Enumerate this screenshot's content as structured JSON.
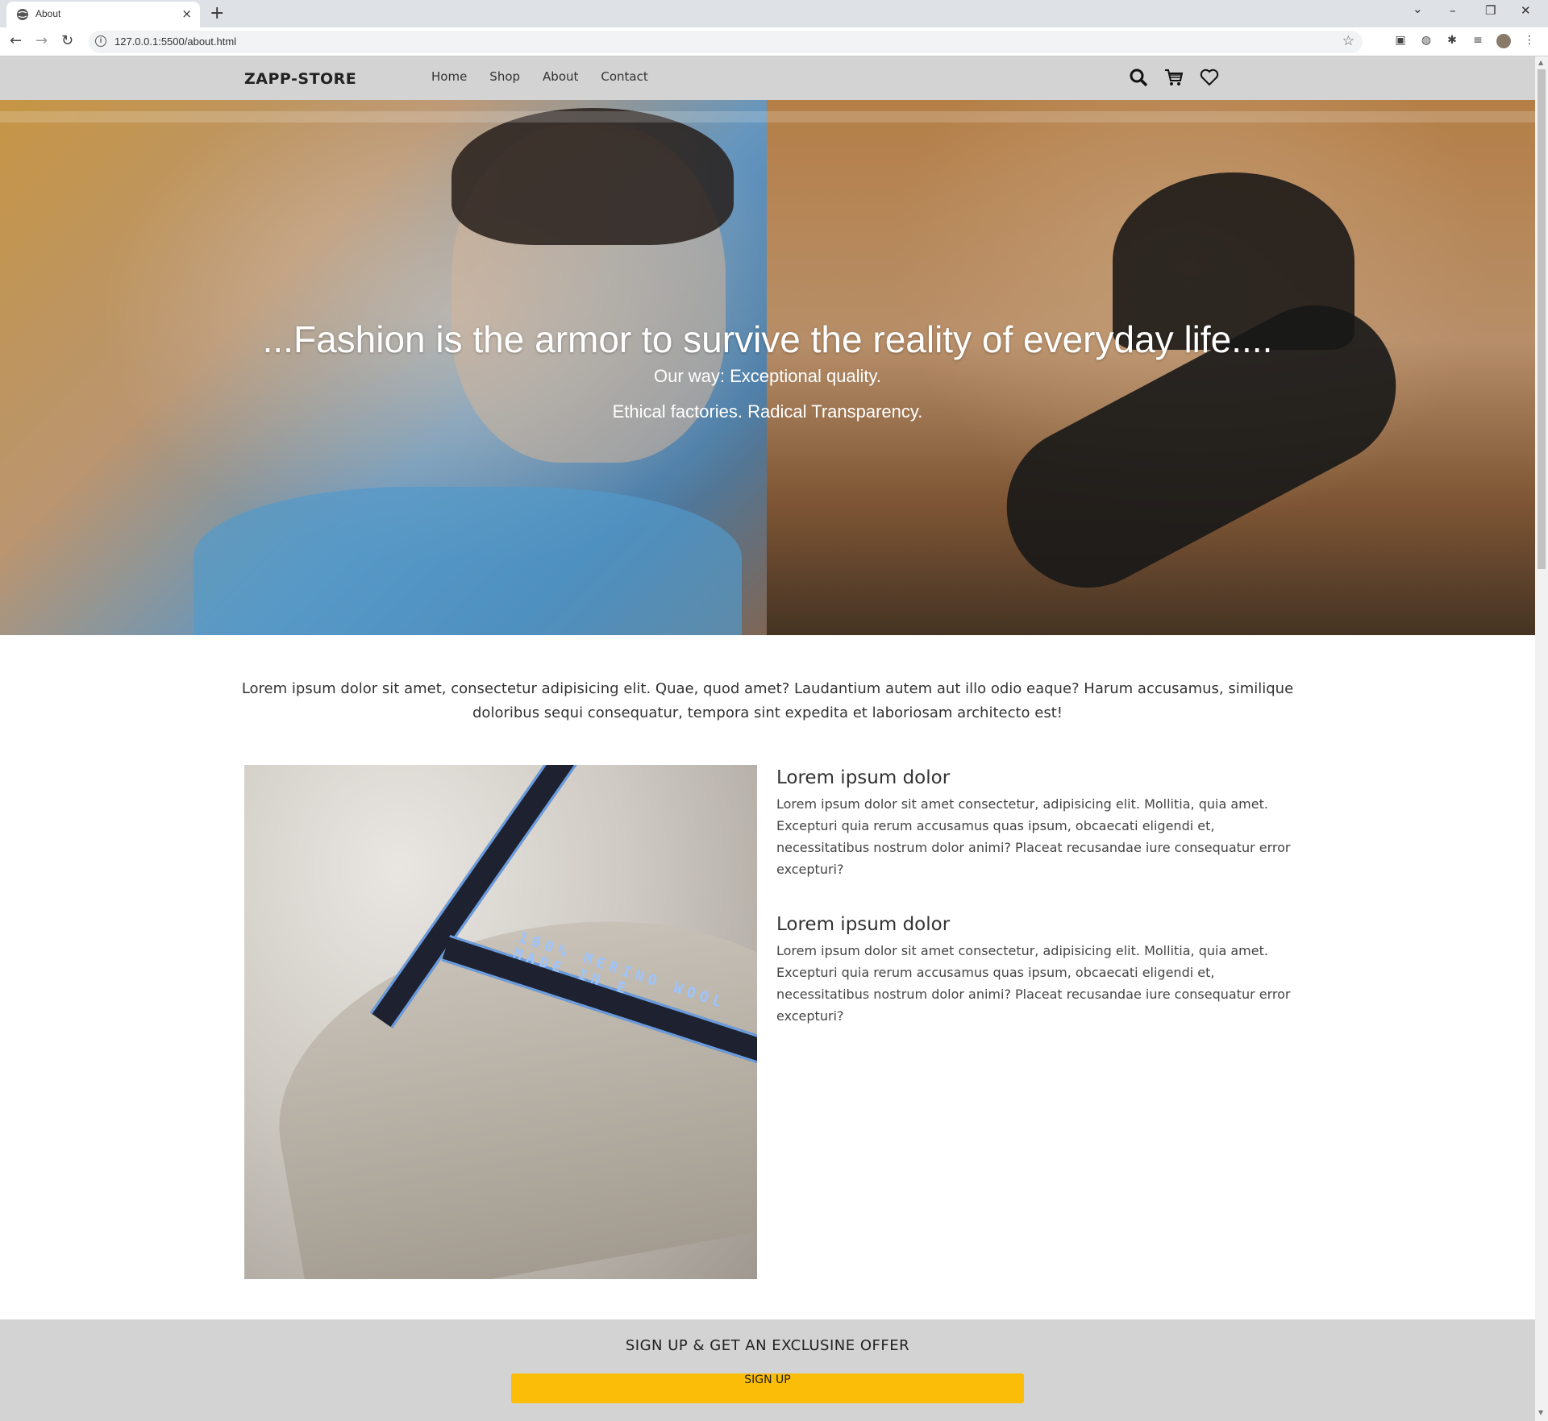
{
  "browser": {
    "tab_title": "About",
    "tab_close": "×",
    "new_tab": "+",
    "url": "127.0.0.1:5500/about.html",
    "window_controls": [
      "–",
      "❐",
      "✕"
    ]
  },
  "nav": {
    "brand": "ZAPP-STORE",
    "links": [
      "Home",
      "Shop",
      "About",
      "Contact"
    ],
    "icons": [
      "search-icon",
      "cart-icon",
      "heart-icon"
    ]
  },
  "hero": {
    "quote": "...Fashion is the armor to survive the reality of everyday life....",
    "line1": "Our way: Exceptional quality.",
    "line2": "Ethical factories. Radical Transparency."
  },
  "intro": "Lorem ipsum dolor sit amet, consectetur adipisicing elit. Quae, quod amet? Laudantium autem aut illo odio eaque? Harum accusamus, similique doloribus sequi consequatur, tempora sint expedita et laboriosam architecto est!",
  "image_text": "100% MERINO WOOL MADE IN E",
  "blocks": [
    {
      "title": "Lorem ipsum dolor",
      "text": "Lorem ipsum dolor sit amet consectetur, adipisicing elit. Mollitia, quia amet. Excepturi quia rerum accusamus quas ipsum, obcaecati eligendi et, necessitatibus nostrum dolor animi? Placeat recusandae iure consequatur error excepturi?"
    },
    {
      "title": "Lorem ipsum dolor",
      "text": "Lorem ipsum dolor sit amet consectetur, adipisicing elit. Mollitia, quia amet. Excepturi quia rerum accusamus quas ipsum, obcaecati eligendi et, necessitatibus nostrum dolor animi? Placeat recusandae iure consequatur error excepturi?"
    }
  ],
  "signup": {
    "heading": "SIGN UP & GET AN EXCLUSINE OFFER",
    "button": "SIGN UP"
  },
  "colors": {
    "nav_bg": "#d3d3d3",
    "signup_button": "#fbbd08"
  }
}
